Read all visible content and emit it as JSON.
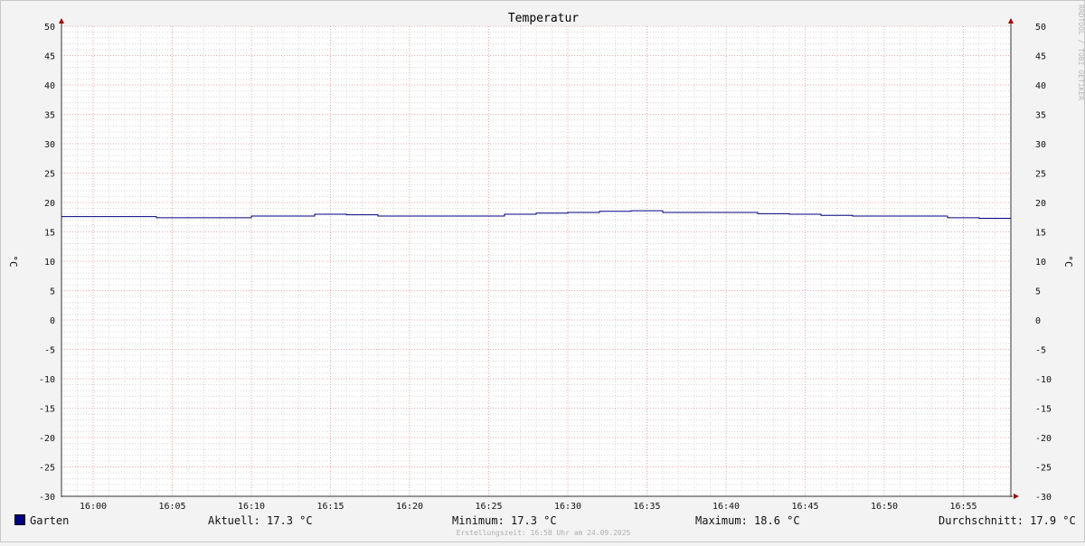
{
  "chart_data": {
    "type": "line",
    "title": "Temperatur",
    "ylabel_left": "°C",
    "ylabel_right": "°C",
    "ylim": [
      -30,
      50
    ],
    "yticks": [
      50,
      45,
      40,
      35,
      30,
      25,
      20,
      15,
      10,
      5,
      0,
      -5,
      -10,
      -15,
      -20,
      -25,
      -30
    ],
    "xticks": [
      "16:00",
      "16:05",
      "16:10",
      "16:15",
      "16:20",
      "16:25",
      "16:30",
      "16:35",
      "16:40",
      "16:45",
      "16:50",
      "16:55"
    ],
    "xlim": [
      "15:58",
      "16:58"
    ],
    "grid": true,
    "series": [
      {
        "name": "Garten",
        "color": "#000080",
        "points": [
          [
            "15:58",
            17.6
          ],
          [
            "16:04",
            17.4
          ],
          [
            "16:10",
            17.7
          ],
          [
            "16:14",
            18.0
          ],
          [
            "16:16",
            17.9
          ],
          [
            "16:18",
            17.7
          ],
          [
            "16:26",
            18.0
          ],
          [
            "16:28",
            18.2
          ],
          [
            "16:30",
            18.3
          ],
          [
            "16:32",
            18.5
          ],
          [
            "16:34",
            18.6
          ],
          [
            "16:36",
            18.3
          ],
          [
            "16:42",
            18.1
          ],
          [
            "16:44",
            18.0
          ],
          [
            "16:46",
            17.8
          ],
          [
            "16:48",
            17.7
          ],
          [
            "16:54",
            17.4
          ],
          [
            "16:56",
            17.3
          ],
          [
            "16:58",
            17.3
          ]
        ]
      }
    ]
  },
  "legend": {
    "series_name": "Garten",
    "swatch_color": "#000080",
    "current": "Aktuell: 17.3 °C",
    "minimum": "Minimum: 17.3 °C",
    "maximum": "Maximum: 18.6 °C",
    "average": "Durchschnitt: 17.9 °C"
  },
  "footer": "Erstellungszeit: 16:58 Uhr am 24.09.2025",
  "watermark": "RRDTOOL / TOBI OETIKER"
}
